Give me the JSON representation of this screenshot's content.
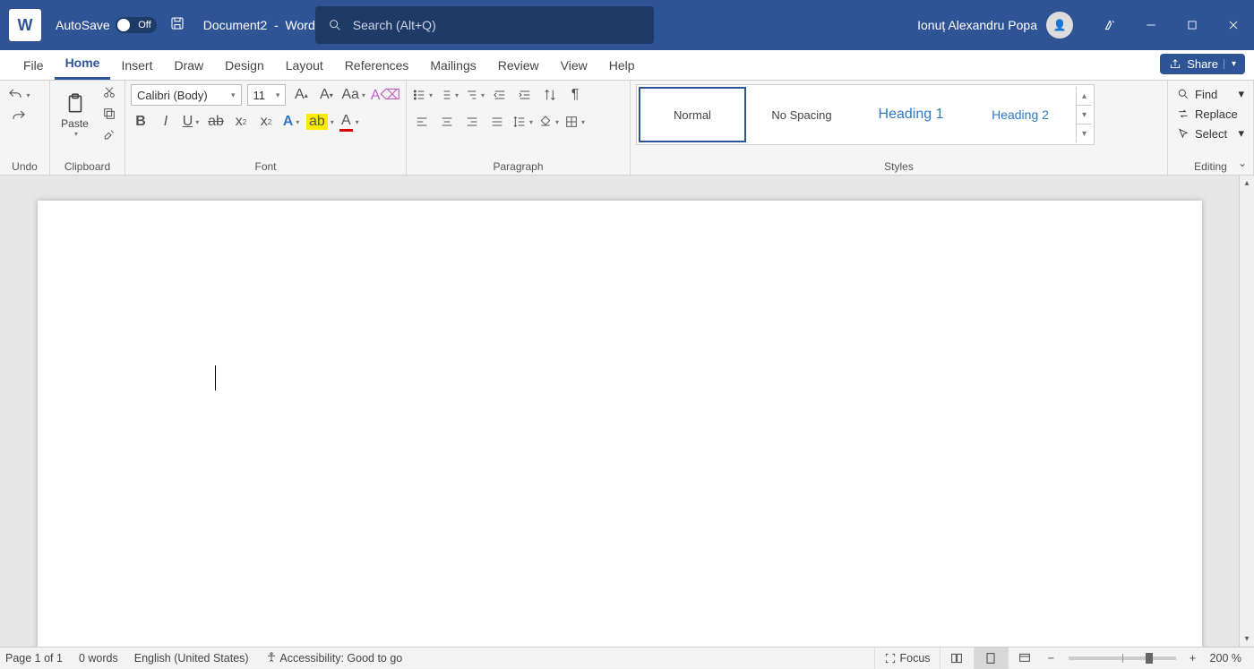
{
  "title": {
    "autosave": "AutoSave",
    "autosave_state": "Off",
    "doc": "Document2",
    "sep": "-",
    "app": "Word"
  },
  "search": {
    "placeholder": "Search (Alt+Q)"
  },
  "user": {
    "name": "Ionuț Alexandru Popa"
  },
  "tabs": [
    "File",
    "Home",
    "Insert",
    "Draw",
    "Design",
    "Layout",
    "References",
    "Mailings",
    "Review",
    "View",
    "Help"
  ],
  "active_tab": 1,
  "share": "Share",
  "groups": {
    "undo": "Undo",
    "clipboard": "Clipboard",
    "paste": "Paste",
    "font": "Font",
    "paragraph": "Paragraph",
    "styles": "Styles",
    "editing": "Editing"
  },
  "font": {
    "name": "Calibri (Body)",
    "size": "11"
  },
  "styles": [
    "Normal",
    "No Spacing",
    "Heading 1",
    "Heading 2"
  ],
  "editing": {
    "find": "Find",
    "replace": "Replace",
    "select": "Select"
  },
  "status": {
    "page": "Page 1 of 1",
    "words": "0 words",
    "lang": "English (United States)",
    "a11y": "Accessibility: Good to go",
    "focus": "Focus",
    "zoom": "200 %"
  }
}
